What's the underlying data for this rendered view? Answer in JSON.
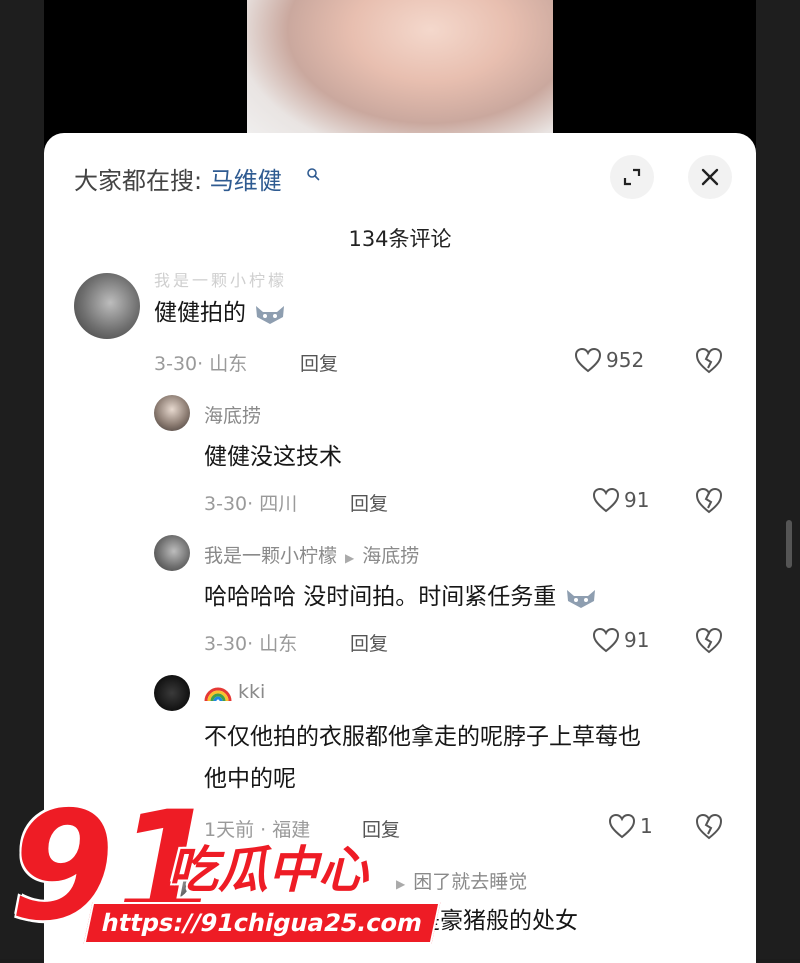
{
  "sheet": {
    "search_hint_prefix": "大家都在搜:",
    "search_hint_term": "马维健",
    "comment_count": "134条评论"
  },
  "comments": [
    {
      "username": "我是一颗小柠檬",
      "text": "健健拍的",
      "meta": "3-30· 山东",
      "reply_label": "回复",
      "likes": "952"
    }
  ],
  "replies": [
    {
      "username": "海底捞",
      "text": "健健没这技术",
      "meta": "3-30· 四川",
      "reply_label": "回复",
      "likes": "91"
    },
    {
      "username": "我是一颗小柠檬",
      "reply_to": "海底捞",
      "text": "哈哈哈哈 没时间拍。时间紧任务重",
      "meta": "3-30· 山东",
      "reply_label": "回复",
      "likes": "91"
    },
    {
      "username": "kki",
      "text_line1": "不仅他拍的衣服都他拿走的呢脖子上草莓也",
      "text_line2": "他中的呢",
      "meta": "1天前 · 福建",
      "reply_label": "回复",
      "likes": "1"
    },
    {
      "reply_to": "困了就去睡觉",
      "text": "还是豪猪般的处女"
    }
  ],
  "watermark": {
    "number": "91",
    "brand": "吃瓜中心",
    "url": "https://91chigua25.com"
  },
  "icons": {
    "expand": "expand-icon",
    "close": "close-icon",
    "heart": "heart-icon",
    "dislike": "broken-heart-icon"
  }
}
